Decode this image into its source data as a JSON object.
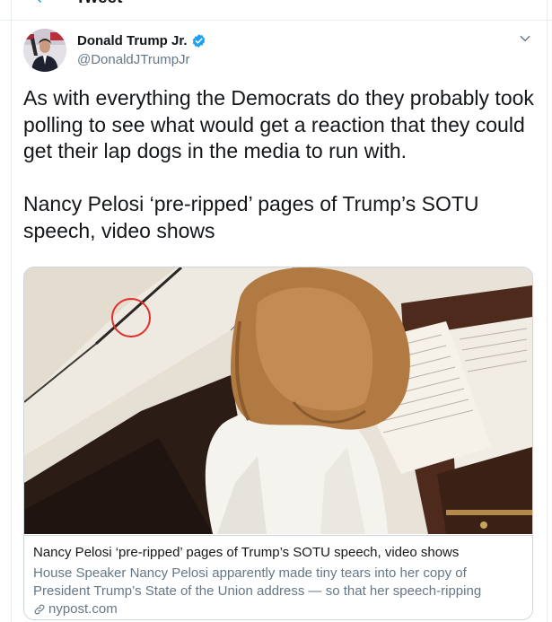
{
  "header": {
    "title": "Tweet"
  },
  "author": {
    "name": "Donald Trump Jr.",
    "handle": "@DonaldJTrumpJr"
  },
  "tweet": {
    "paragraph_1": "As with everything the Democrats do they probably took polling to see what would get a reaction that they could get their lap dogs in the media to run with.",
    "paragraph_2": "Nancy Pelosi ‘pre-ripped’ pages of Trump’s SOTU speech, video shows"
  },
  "card": {
    "title": "Nancy Pelosi ‘pre-ripped’ pages of Trump’s SOTU speech, video shows",
    "description": "House Speaker Nancy Pelosi apparently made tiny tears into her copy of President Trump’s State of the Union address — so that her speech-ripping moment could …",
    "domain": "nypost.com"
  },
  "icons": {
    "back": "arrow-left-icon",
    "verified": "verified-badge-icon",
    "more": "chevron-down-icon",
    "link": "link-icon"
  },
  "colors": {
    "accent": "#1da1f2",
    "text": "#14171a",
    "muted": "#657786",
    "border": "#ccd6dd",
    "annotation_circle": "#e0302a"
  }
}
